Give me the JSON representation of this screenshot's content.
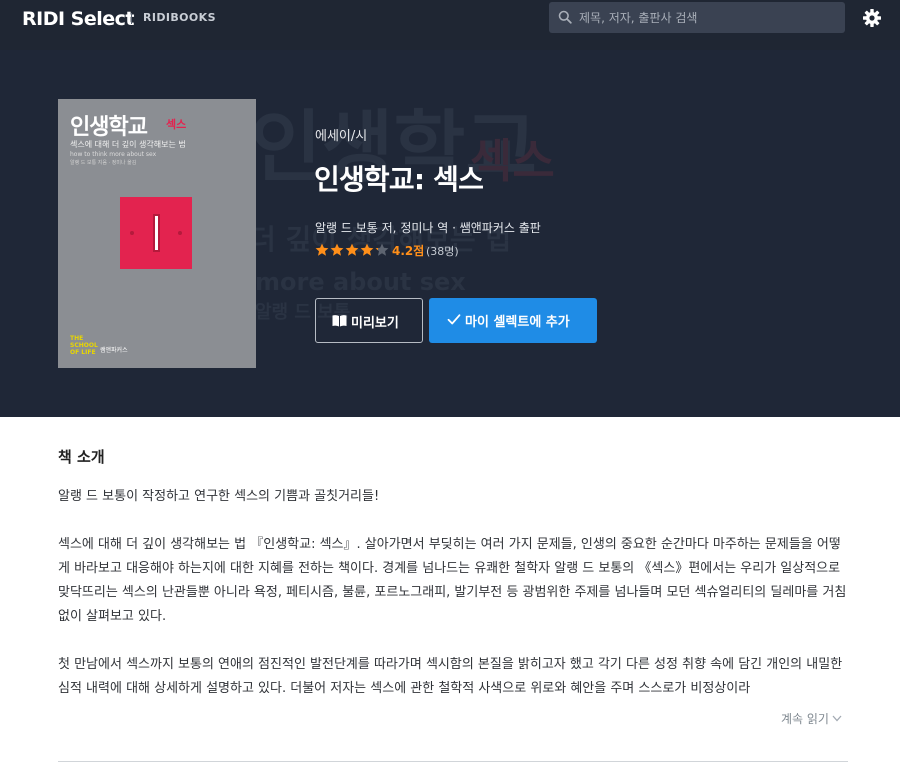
{
  "nav": {
    "logo": "RIDI Select",
    "sublogo": "RIDIBOOKS",
    "search_placeholder": "제목, 저자, 출판사 검색"
  },
  "hero": {
    "bg_title": "인생학교",
    "bg_tag": "섹스",
    "bg_line1": "더 깊이 생각해보는 법",
    "bg_line2": "more about sex",
    "bg_line3": "알랭 드 보통"
  },
  "cover": {
    "title": "인생학교",
    "tag": "섹스",
    "subtitle": "섹스에 대해 더 깊이 생각해보는 법",
    "subtitle_en": "how to think more about sex",
    "author_line": "알랭 드 보통 지음 · 정미나 옮김",
    "series_logo": "THE SCHOOL OF LIFE",
    "publisher_logo": "쌤앤파커스"
  },
  "book": {
    "category": "에세이/시",
    "title": "인생학교: 섹스",
    "authors": "알랭 드 보통 저, 정미나 역 · 쌤앤파커스 출판",
    "rating": 4.2,
    "score_label": "4.2점",
    "count_label": "(38명)"
  },
  "buttons": {
    "preview": "미리보기",
    "add": "마이 셀렉트에 추가"
  },
  "intro": {
    "heading": "책 소개",
    "lead": "알랭 드 보통이 작정하고 연구한 섹스의 기쁨과 골칫거리들!",
    "para1": "섹스에 대해 더 깊이 생각해보는 법 『인생학교: 섹스』. 살아가면서 부딪히는 여러 가지 문제들, 인생의 중요한 순간마다 마주하는 문제들을 어떻게 바라보고 대응해야 하는지에 대한 지혜를 전하는 책이다. 경계를 넘나드는 유쾌한 철학자 알랭 드 보통의 《섹스》편에서는 우리가 일상적으로 맞닥뜨리는 섹스의 난관들뿐 아니라 욕정, 페티시즘, 불륜, 포르노그래피, 발기부전 등 광범위한 주제를 넘나들며 모던 섹슈얼리티의 딜레마를 거침없이 살펴보고 있다.",
    "para2": "첫 만남에서 섹스까지 보통의 연애의 점진적인 발전단계를 따라가며 섹시함의 본질을 밝히고자 했고 각기 다른 성정 취향 속에 담긴 개인의 내밀한 심적 내력에 대해 상세하게 설명하고 있다. 더불어 저자는 섹스에 관한 철학적 사색으로 위로와 혜안을 주며 스스로가 비정상이라",
    "more": "계속 읽기"
  },
  "colors": {
    "nav_bg": "#1f2633",
    "hero_bg": "#1f2737",
    "accent": "#1f8ce6",
    "star": "#ff8f19",
    "cover_red": "#e3234f"
  }
}
